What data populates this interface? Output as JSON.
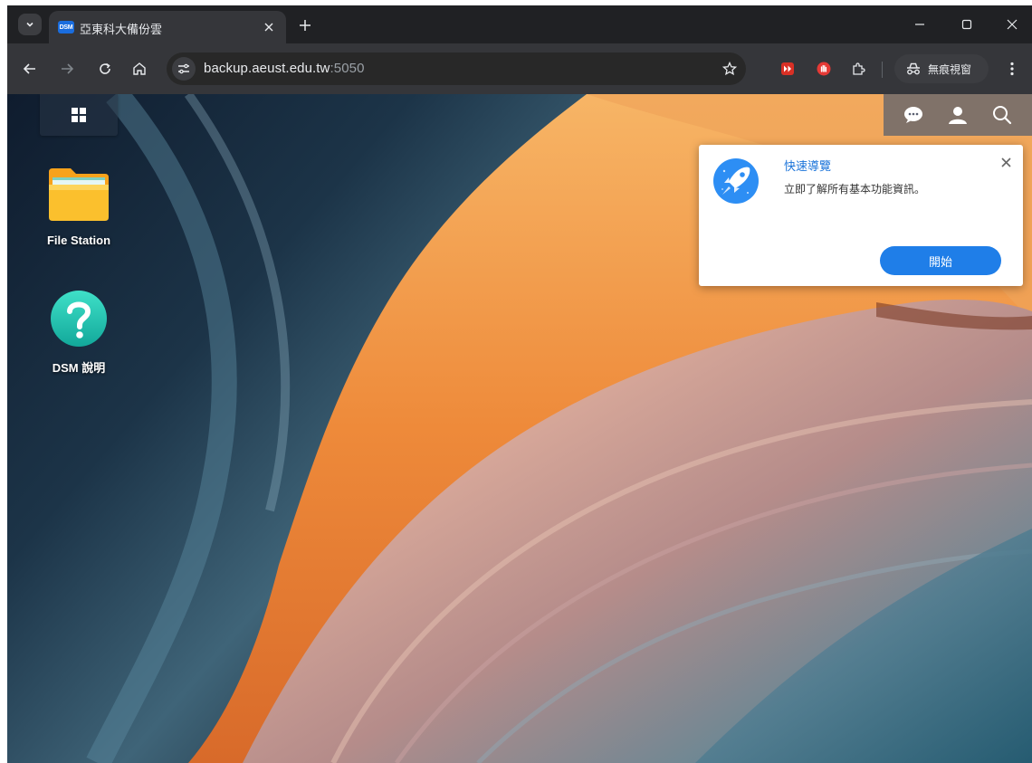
{
  "browser": {
    "tab": {
      "favicon_text": "DSM",
      "title": "亞東科大備份雲"
    },
    "url": {
      "host": "backup.aeust.edu.tw",
      "port": ":5050"
    },
    "incognito_label": "無痕視窗",
    "icons": [
      "tab-search-icon",
      "close-icon",
      "plus-icon",
      "minimize-icon",
      "maximize-icon",
      "back-icon",
      "forward-icon",
      "reload-icon",
      "home-icon",
      "site-info-icon",
      "star-icon",
      "extension-icon",
      "incognito-icon",
      "more-vert-icon"
    ]
  },
  "desktop": {
    "apps": [
      {
        "label": "File Station",
        "icon": "folder-icon"
      },
      {
        "label": "DSM 說明",
        "icon": "help-icon"
      }
    ],
    "tray_icons": [
      "chat-icon",
      "user-icon",
      "search-icon"
    ],
    "main_menu_icon": "grid-menu-icon"
  },
  "notification": {
    "title": "快速導覽",
    "description": "立即了解所有基本功能資訊。",
    "button_label": "開始",
    "icon": "rocket-icon"
  },
  "colors": {
    "accent": "#1f7ee8",
    "title_blue": "#1a73d9",
    "favicon_blue": "#1a6dde",
    "chrome_dark": "#202124",
    "toolbar": "#35363a"
  }
}
